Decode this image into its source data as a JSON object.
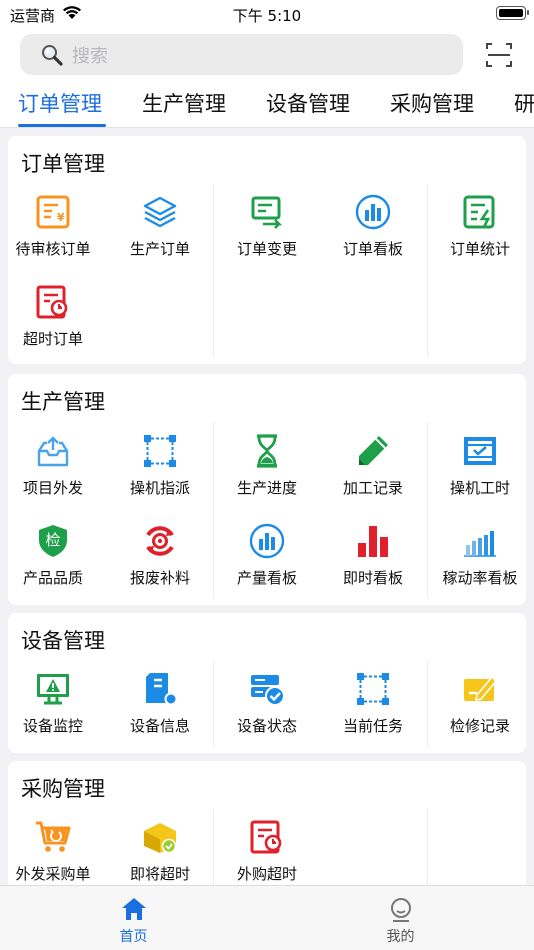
{
  "status": {
    "carrier": "运营商",
    "time": "下午 5:10"
  },
  "search": {
    "placeholder": "搜索"
  },
  "tabs": [
    {
      "label": "订单管理",
      "active": true
    },
    {
      "label": "生产管理",
      "active": false
    },
    {
      "label": "设备管理",
      "active": false
    },
    {
      "label": "采购管理",
      "active": false
    },
    {
      "label": "研",
      "active": false
    }
  ],
  "sections": {
    "order": {
      "title": "订单管理",
      "items": [
        "待审核订单",
        "生产订单",
        "订单变更",
        "订单看板",
        "订单统计",
        "超时订单"
      ]
    },
    "production": {
      "title": "生产管理",
      "items": [
        "项目外发",
        "操机指派",
        "生产进度",
        "加工记录",
        "操机工时",
        "产品品质",
        "报废补料",
        "产量看板",
        "即时看板",
        "稼动率看板"
      ],
      "quality_badge": "检"
    },
    "equipment": {
      "title": "设备管理",
      "items": [
        "设备监控",
        "设备信息",
        "设备状态",
        "当前任务",
        "检修记录"
      ]
    },
    "purchase": {
      "title": "采购管理",
      "items": [
        "外发采购单",
        "即将超时",
        "外购超时"
      ]
    }
  },
  "tabbar": {
    "home": "首页",
    "mine": "我的"
  },
  "colors": {
    "accent": "#1c6fe0",
    "orange": "#f7931e",
    "green": "#1ea04b",
    "red": "#e0202a",
    "blue": "#1c8be6",
    "yellow": "#f5c518"
  }
}
